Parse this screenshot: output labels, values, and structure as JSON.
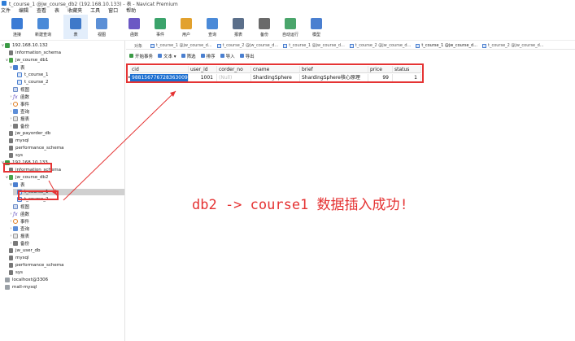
{
  "window": {
    "title": "t_course_1 @jw_course_db2 (192.168.10.133) - 表 - Navicat Premium"
  },
  "menu": [
    "文件",
    "编辑",
    "查看",
    "表",
    "收藏夹",
    "工具",
    "窗口",
    "帮助"
  ],
  "toolbar": [
    {
      "label": "连接",
      "icon": "plug-icon",
      "color": "#3a7bd5"
    },
    {
      "label": "新建查询",
      "icon": "new-query-icon",
      "color": "#4a8ad8"
    },
    {
      "label": "表",
      "icon": "table-icon",
      "color": "#3f79c9",
      "active": true
    },
    {
      "label": "视图",
      "icon": "view-icon",
      "color": "#5b8fd6"
    },
    {
      "label": "函数",
      "icon": "function-icon",
      "color": "#6b58c4"
    },
    {
      "label": "事件",
      "icon": "event-icon",
      "color": "#3ba36b"
    },
    {
      "label": "用户",
      "icon": "user-icon",
      "color": "#e2a12e"
    },
    {
      "label": "查询",
      "icon": "query-icon",
      "color": "#4a8ad8"
    },
    {
      "label": "报表",
      "icon": "report-icon",
      "color": "#5b6f8a"
    },
    {
      "label": "备份",
      "icon": "backup-icon",
      "color": "#6a6a6a"
    },
    {
      "label": "自动运行",
      "icon": "automation-icon",
      "color": "#4aa56b"
    },
    {
      "label": "模型",
      "icon": "model-icon",
      "color": "#4a7fd0"
    }
  ],
  "tree": [
    {
      "label": "192.168.10.132",
      "icon": "connection-icon",
      "type": "conn",
      "indent": 0,
      "toggle": "∨"
    },
    {
      "label": "information_schema",
      "icon": "database-icon",
      "type": "db",
      "indent": 1,
      "toggle": ""
    },
    {
      "label": "jw_course_db1",
      "icon": "database-icon",
      "type": "db-green",
      "indent": 1,
      "toggle": "∨"
    },
    {
      "label": "表",
      "icon": "table-folder-icon",
      "type": "tablefolder",
      "indent": 2,
      "toggle": "∨"
    },
    {
      "label": "t_course_1",
      "icon": "table-icon",
      "type": "table",
      "indent": 3,
      "toggle": ""
    },
    {
      "label": "t_course_2",
      "icon": "table-icon",
      "type": "table",
      "indent": 3,
      "toggle": ""
    },
    {
      "label": "视图",
      "icon": "view-icon",
      "type": "view",
      "indent": 2,
      "toggle": ""
    },
    {
      "label": "函数",
      "icon": "function-icon",
      "type": "func",
      "indent": 2,
      "toggle": "›"
    },
    {
      "label": "事件",
      "icon": "event-icon",
      "type": "event",
      "indent": 2,
      "toggle": "›"
    },
    {
      "label": "查询",
      "icon": "query-icon",
      "type": "query",
      "indent": 2,
      "toggle": "›"
    },
    {
      "label": "报表",
      "icon": "report-icon",
      "type": "report",
      "indent": 2,
      "toggle": "›"
    },
    {
      "label": "备份",
      "icon": "backup-icon",
      "type": "backup",
      "indent": 2,
      "toggle": "›"
    },
    {
      "label": "jw_payorder_db",
      "icon": "database-icon",
      "type": "db",
      "indent": 1,
      "toggle": ""
    },
    {
      "label": "mysql",
      "icon": "database-icon",
      "type": "db",
      "indent": 1,
      "toggle": ""
    },
    {
      "label": "performance_schema",
      "icon": "database-icon",
      "type": "db",
      "indent": 1,
      "toggle": ""
    },
    {
      "label": "sys",
      "icon": "database-icon",
      "type": "db",
      "indent": 1,
      "toggle": ""
    },
    {
      "label": "192.168.10.133",
      "icon": "connection-icon",
      "type": "conn",
      "indent": 0,
      "toggle": "∨"
    },
    {
      "label": "information_schema",
      "icon": "database-icon",
      "type": "db",
      "indent": 1,
      "toggle": ""
    },
    {
      "label": "jw_course_db2",
      "icon": "database-icon",
      "type": "db-green",
      "indent": 1,
      "toggle": "∨"
    },
    {
      "label": "表",
      "icon": "table-folder-icon",
      "type": "tablefolder",
      "indent": 2,
      "toggle": "∨"
    },
    {
      "label": "t_course_1",
      "icon": "table-icon",
      "type": "table",
      "indent": 3,
      "toggle": "",
      "selected": true
    },
    {
      "label": "t_course_2",
      "icon": "table-icon",
      "type": "table",
      "indent": 3,
      "toggle": ""
    },
    {
      "label": "视图",
      "icon": "view-icon",
      "type": "view",
      "indent": 2,
      "toggle": ""
    },
    {
      "label": "函数",
      "icon": "function-icon",
      "type": "func",
      "indent": 2,
      "toggle": "›"
    },
    {
      "label": "事件",
      "icon": "event-icon",
      "type": "event",
      "indent": 2,
      "toggle": "›"
    },
    {
      "label": "查询",
      "icon": "query-icon",
      "type": "query",
      "indent": 2,
      "toggle": "›"
    },
    {
      "label": "报表",
      "icon": "report-icon",
      "type": "report",
      "indent": 2,
      "toggle": "›"
    },
    {
      "label": "备份",
      "icon": "backup-icon",
      "type": "backup",
      "indent": 2,
      "toggle": "›"
    },
    {
      "label": "jw_user_db",
      "icon": "database-icon",
      "type": "db",
      "indent": 1,
      "toggle": ""
    },
    {
      "label": "mysql",
      "icon": "database-icon",
      "type": "db",
      "indent": 1,
      "toggle": ""
    },
    {
      "label": "performance_schema",
      "icon": "database-icon",
      "type": "db",
      "indent": 1,
      "toggle": ""
    },
    {
      "label": "sys",
      "icon": "database-icon",
      "type": "db",
      "indent": 1,
      "toggle": ""
    },
    {
      "label": "localhost@3306",
      "icon": "connection-icon",
      "type": "conn-gray",
      "indent": 0,
      "toggle": ""
    },
    {
      "label": "mall-mysql",
      "icon": "connection-icon",
      "type": "conn-gray",
      "indent": 0,
      "toggle": ""
    }
  ],
  "tabs": [
    {
      "label": "对象",
      "active": false,
      "kind": "objects"
    },
    {
      "label": "t_course_1 @jw_course_d...",
      "active": false
    },
    {
      "label": "t_course_2 @jw_course_d...",
      "active": false
    },
    {
      "label": "t_course_1 @jw_course_d...",
      "active": false
    },
    {
      "label": "t_course_2 @jw_course_d...",
      "active": false
    },
    {
      "label": "t_course_1 @jw_course_d...",
      "active": true
    },
    {
      "label": "t_course_2 @jw_course_d...",
      "active": false
    }
  ],
  "actions": [
    {
      "label": "开始事务",
      "icon": "transaction-icon",
      "color": "#3a9a45"
    },
    {
      "label": "文本 ▾",
      "icon": "text-icon",
      "color": "#4a7fd0"
    },
    {
      "label": "筛选",
      "icon": "filter-icon",
      "color": "#4a7fd0"
    },
    {
      "label": "排序",
      "icon": "sort-icon",
      "color": "#4a7fd0"
    },
    {
      "label": "导入",
      "icon": "import-icon",
      "color": "#4a7fd0"
    },
    {
      "label": "导出",
      "icon": "export-icon",
      "color": "#4a7fd0"
    }
  ],
  "grid": {
    "columns": [
      "cid",
      "user_id",
      "corder_no",
      "cname",
      "brief",
      "price",
      "status"
    ],
    "rows": [
      [
        "988156776728363009",
        "1001",
        "(Null)",
        "ShardingSphere",
        "ShardingSphere核心原理",
        "99",
        "1"
      ]
    ]
  },
  "annotation": "db2 -> course1 数据插入成功!",
  "colors": {
    "annotation": "#e53333",
    "selection": "#1c6fd1",
    "accent": "#2e7dd7"
  }
}
